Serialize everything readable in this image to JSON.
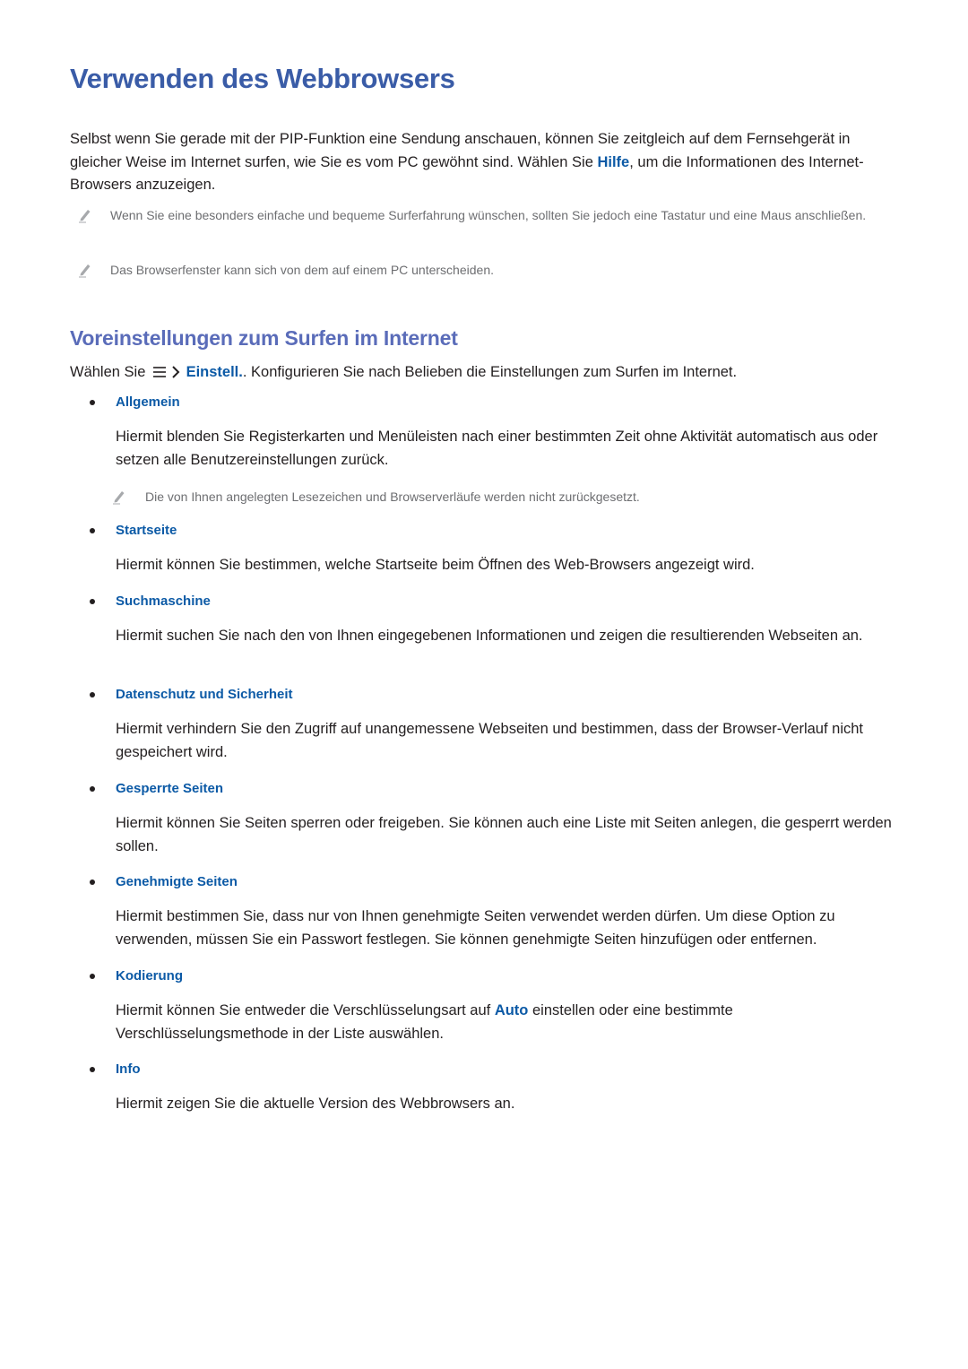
{
  "title": "Verwenden des Webbrowsers",
  "intro": {
    "part1": "Selbst wenn Sie gerade mit der PIP-Funktion eine Sendung anschauen, können Sie zeitgleich auf dem Fernsehgerät in gleicher Weise im Internet surfen, wie Sie es vom PC gewöhnt sind. Wählen Sie ",
    "link": "Hilfe",
    "part2": ", um die Informationen des Internet-Browsers anzuzeigen."
  },
  "notes": [
    {
      "icon": "pencil-icon",
      "text": "Wenn Sie eine besonders einfache und bequeme Surferfahrung wünschen, sollten Sie jedoch eine Tastatur und eine Maus anschließen."
    },
    {
      "icon": "pencil-icon",
      "text": "Das Browserfenster kann sich von dem auf einem PC unterscheiden."
    }
  ],
  "section": {
    "heading": "Voreinstellungen zum Surfen im Internet",
    "choose_prefix": "Wählen Sie",
    "menu_icon": "menu-icon",
    "arrow_icon": "chevron-right-icon",
    "choose_link": "Einstell.",
    "choose_suffix": ". Konfigurieren Sie nach Belieben die Einstellungen zum Surfen im Internet.",
    "items": [
      {
        "label": "Allgemein",
        "desc": "Hiermit blenden Sie Registerkarten und Menüleisten nach einer bestimmten Zeit ohne Aktivität automatisch aus oder setzen alle Benutzereinstellungen zurück.",
        "note": "Die von Ihnen angelegten Lesezeichen und Browserverläufe werden nicht zurückgesetzt."
      },
      {
        "label": "Startseite",
        "desc": "Hiermit können Sie bestimmen, welche Startseite beim Öffnen des Web-Browsers angezeigt wird."
      },
      {
        "label": "Suchmaschine",
        "desc": "Hiermit suchen Sie nach den von Ihnen eingegebenen Informationen und zeigen die resultierenden Webseiten an."
      },
      {
        "label": "Datenschutz und Sicherheit",
        "desc": "Hiermit verhindern Sie den Zugriff auf unangemessene Webseiten und bestimmen, dass der Browser-Verlauf nicht gespeichert wird."
      },
      {
        "label": "Gesperrte Seiten",
        "desc": "Hiermit können Sie Seiten sperren oder freigeben. Sie können auch eine Liste mit Seiten anlegen, die gesperrt werden sollen."
      },
      {
        "label": "Genehmigte Seiten",
        "desc": "Hiermit bestimmen Sie, dass nur von Ihnen genehmigte Seiten verwendet werden dürfen. Um diese Option zu verwenden, müssen Sie ein Passwort festlegen. Sie können genehmigte Seiten hinzufügen oder entfernen."
      },
      {
        "label": "Kodierung",
        "desc_part1": "Hiermit können Sie entweder die Verschlüsselungsart auf ",
        "desc_link": "Auto",
        "desc_part2": " einstellen oder eine bestimmte Verschlüsselungsmethode in der Liste auswählen."
      },
      {
        "label": "Info",
        "desc": "Hiermit zeigen Sie die aktuelle Version des Webbrowsers an."
      }
    ]
  },
  "colors": {
    "title": "#3a5ca7",
    "subheading": "#5a6cb9",
    "link": "#0c5aa6",
    "body": "#231f20",
    "note": "#6d6e71"
  }
}
